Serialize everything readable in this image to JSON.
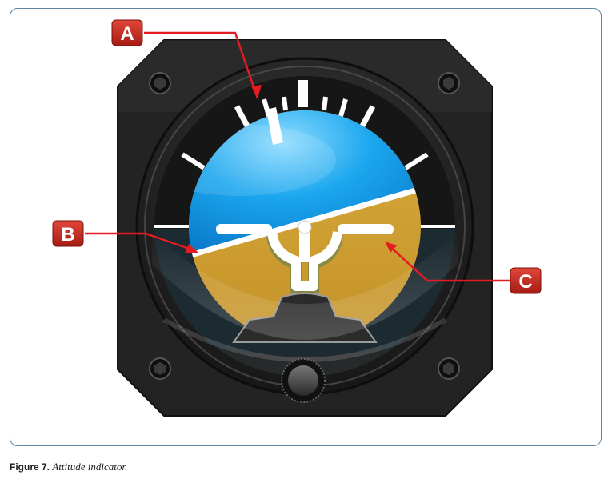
{
  "caption": {
    "figure_label": "Figure 7.",
    "description": "Attitude indicator."
  },
  "callouts": [
    {
      "letter": "A"
    },
    {
      "letter": "B"
    },
    {
      "letter": "C"
    }
  ],
  "colors": {
    "frame_border": "#5f86a3",
    "sky": "#1aa6ee",
    "ground": "#d0a232",
    "bezel": "#1f1f1f",
    "callout_fill": "#c9281e",
    "leader_line": "#e31b23"
  }
}
